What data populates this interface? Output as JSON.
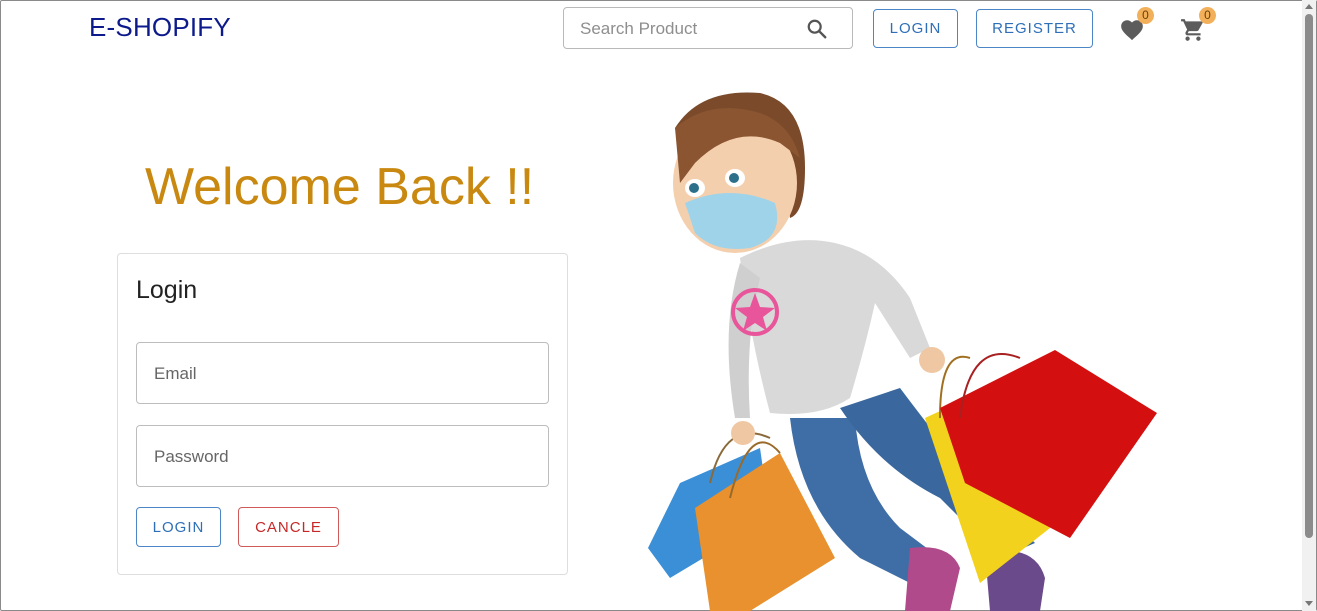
{
  "header": {
    "brand": "E-SHOPIFY",
    "search": {
      "placeholder": "Search Product",
      "icon": "search-icon"
    },
    "login_label": "LOGIN",
    "register_label": "REGISTER",
    "wishlist": {
      "icon": "heart-icon",
      "count": "0"
    },
    "cart": {
      "icon": "cart-icon",
      "count": "0"
    }
  },
  "main": {
    "welcome": "Welcome Back !!",
    "login_card": {
      "title": "Login",
      "email_placeholder": "Email",
      "password_placeholder": "Password",
      "login_label": "LOGIN",
      "cancel_label": "CANCLE"
    },
    "hero": {
      "description_icon": "shopping-girl-illustration"
    }
  },
  "colors": {
    "brand": "#0d1a8c",
    "welcome": "#c98810",
    "primary": "#2e6fb7",
    "danger": "#c62828",
    "badge": "#f2b05a"
  }
}
